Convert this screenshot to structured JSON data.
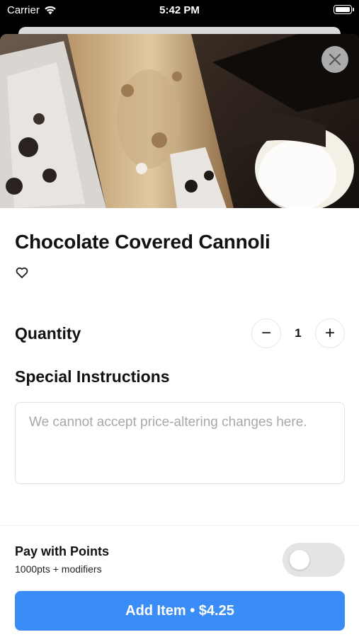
{
  "status_bar": {
    "carrier": "Carrier",
    "time": "5:42 PM"
  },
  "item": {
    "title": "Chocolate Covered Cannoli"
  },
  "quantity": {
    "label": "Quantity",
    "value": "1",
    "decrement": "−",
    "increment": "+"
  },
  "instructions": {
    "label": "Special Instructions",
    "placeholder": "We cannot accept price-altering changes here."
  },
  "points": {
    "title": "Pay with Points",
    "subtitle": "1000pts + modifiers",
    "enabled": false
  },
  "cta": {
    "label": "Add Item • $4.25"
  },
  "colors": {
    "accent": "#3a8cf6",
    "toggle_off": "#e4e4e4",
    "close_bg": "#c8c8c8"
  },
  "icons": [
    "wifi-icon",
    "battery-icon",
    "close-icon",
    "heart-icon"
  ]
}
